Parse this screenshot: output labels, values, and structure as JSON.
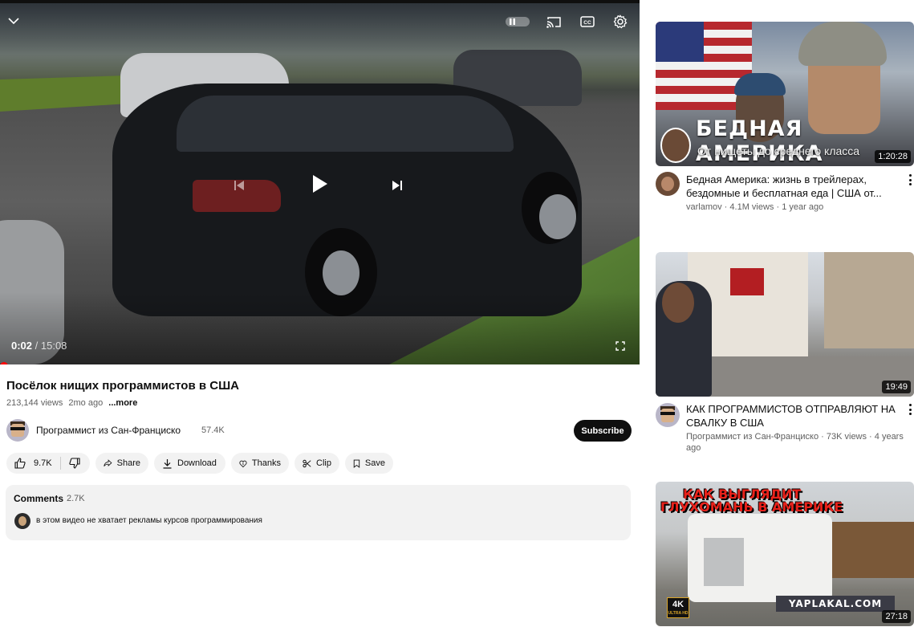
{
  "player": {
    "current_time": "0:02",
    "separator": " / ",
    "total_time": "15:08",
    "progress_fraction": 0.0022,
    "icons": [
      "chevron-down-icon",
      "pause-toggle-icon",
      "cast-icon",
      "captions-icon",
      "settings-icon",
      "previous-icon",
      "play-icon",
      "next-icon",
      "fullscreen-icon"
    ],
    "captions_label": "CC"
  },
  "video": {
    "title": "Посёлок нищих программистов в США",
    "views": "213,144 views",
    "age": "2mo ago",
    "more_label": "...more"
  },
  "channel": {
    "name": "Программист из Сан-Франциско",
    "subscribers": "57.4K",
    "subscribe_label": "Subscribe"
  },
  "actions": {
    "like_count": "9.7K",
    "share_label": "Share",
    "download_label": "Download",
    "thanks_label": "Thanks",
    "clip_label": "Clip",
    "save_label": "Save"
  },
  "comments": {
    "title": "Comments",
    "count": "2.7K",
    "top_comment": "в этом видео не хватает рекламы курсов программирования"
  },
  "sidebar": {
    "videos": [
      {
        "title": "Бедная Америка: жизнь в трейлерах, бездомные и бесплатная еда | США от...",
        "channel": "varlamov",
        "views": "4.1M views",
        "age": "1 year ago",
        "meta_separator": " · ",
        "duration": "1:20:28",
        "thumb_title": "БЕДНАЯ АМЕРИКА",
        "thumb_subtitle": "От нищеты до среднего класса"
      },
      {
        "title": "КАК ПРОГРАММИСТОВ ОТПРАВЛЯЮТ НА СВАЛКУ В США",
        "meta": "Программист из Сан-Франциско · 73K views · 4 years ago",
        "duration": "19:49"
      },
      {
        "thumb_title_line1": "КАК ВЫГЛЯДИТ",
        "thumb_title_line2": "ГЛУХОМАНЬ В АМЕРИКЕ",
        "badge": "4K",
        "badge_sub": "ULTRA HD",
        "watermark": "YAPLAKAL.COM",
        "duration": "27:18"
      }
    ]
  },
  "colors": {
    "accent": "#ff0000",
    "pill_bg": "#f2f2f2",
    "text": "#0f0f0f",
    "secondary_text": "#606060"
  }
}
